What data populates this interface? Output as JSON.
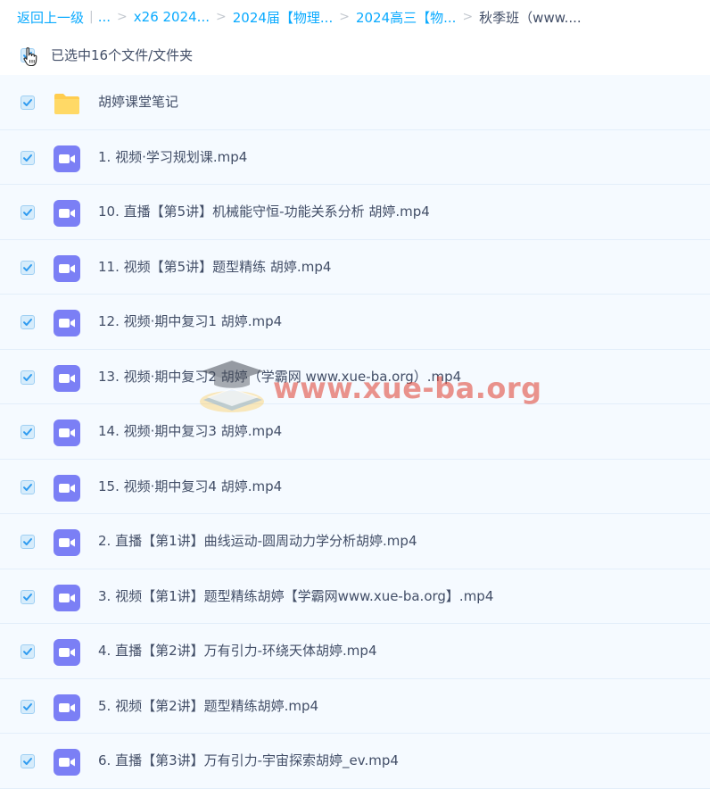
{
  "breadcrumb": {
    "back": "返回上一级",
    "separator_bar": "|",
    "ellipsis": "...",
    "items": [
      "x26 2024...",
      "2024届【物理...",
      "2024高三【物...",
      "秋季班（www...."
    ]
  },
  "selection": {
    "label": "已选中16个文件/文件夹"
  },
  "files": [
    {
      "name": "胡婷课堂笔记",
      "type": "folder",
      "checked": true
    },
    {
      "name": "1. 视频·学习规划课.mp4",
      "type": "video",
      "checked": true
    },
    {
      "name": "10. 直播【第5讲】机械能守恒-功能关系分析 胡婷.mp4",
      "type": "video",
      "checked": true
    },
    {
      "name": "11. 视频【第5讲】题型精练 胡婷.mp4",
      "type": "video",
      "checked": true
    },
    {
      "name": "12. 视频·期中复习1 胡婷.mp4",
      "type": "video",
      "checked": true
    },
    {
      "name": "13. 视频·期中复习2 胡婷（学霸网 www.xue-ba.org）.mp4",
      "type": "video",
      "checked": true
    },
    {
      "name": "14. 视频·期中复习3 胡婷.mp4",
      "type": "video",
      "checked": true
    },
    {
      "name": "15. 视频·期中复习4 胡婷.mp4",
      "type": "video",
      "checked": true
    },
    {
      "name": "2. 直播【第1讲】曲线运动-圆周动力学分析胡婷.mp4",
      "type": "video",
      "checked": true
    },
    {
      "name": "3. 视频【第1讲】题型精练胡婷【学霸网www.xue-ba.org】.mp4",
      "type": "video",
      "checked": true
    },
    {
      "name": "4. 直播【第2讲】万有引力-环绕天体胡婷.mp4",
      "type": "video",
      "checked": true
    },
    {
      "name": "5. 视频【第2讲】题型精练胡婷.mp4",
      "type": "video",
      "checked": true
    },
    {
      "name": "6. 直播【第3讲】万有引力-宇宙探索胡婷_ev.mp4",
      "type": "video",
      "checked": true
    }
  ],
  "watermark": {
    "text": "www.xue-ba.org"
  },
  "colors": {
    "link": "#09aaff",
    "row_bg": "#f5faff",
    "video_icon": "#7b7ff5",
    "folder_icon": "#ffcd4f",
    "checkmark": "#2f9bf0"
  }
}
